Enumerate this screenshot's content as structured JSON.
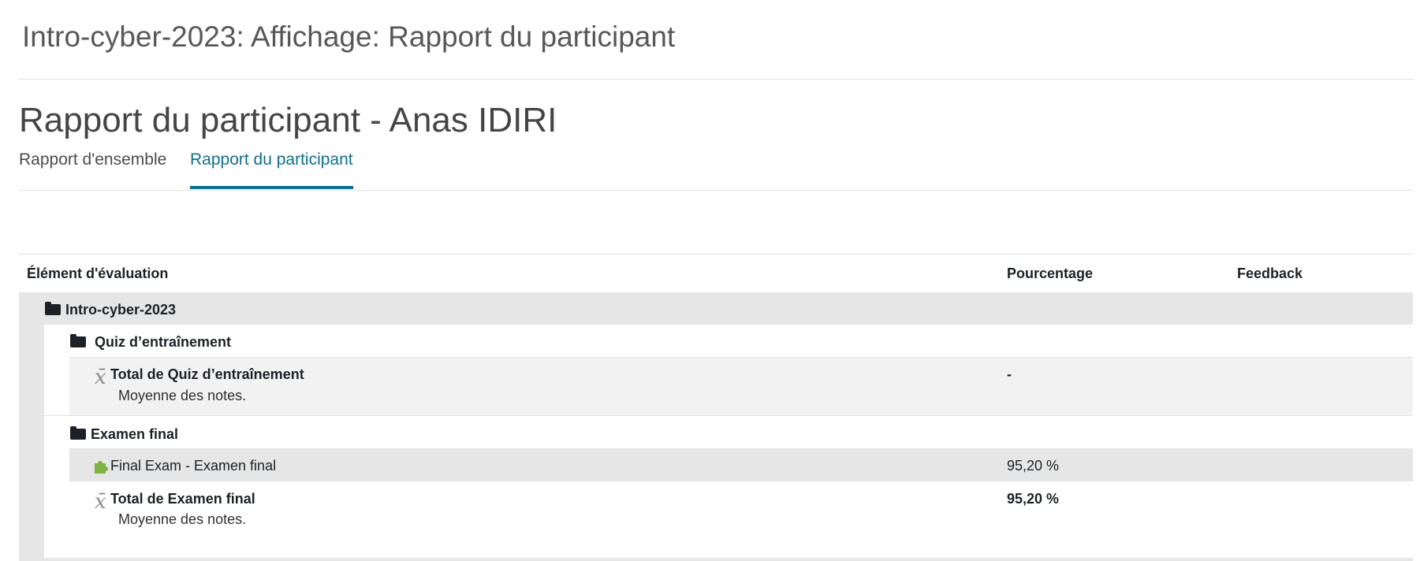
{
  "page": {
    "heading": "Intro-cyber-2023: Affichage: Rapport du participant",
    "report_title": "Rapport du participant - Anas IDIRI"
  },
  "tabs": [
    {
      "label": "Rapport d'ensemble",
      "active": false
    },
    {
      "label": "Rapport du participant",
      "active": true
    }
  ],
  "table": {
    "headers": {
      "item": "Élément d'évaluation",
      "percentage": "Pourcentage",
      "feedback": "Feedback"
    },
    "rows": [
      {
        "type": "category",
        "icon": "folder-icon",
        "name": "Intro-cyber-2023"
      },
      {
        "type": "category",
        "icon": "folder-icon",
        "name": "Quiz d’entraînement"
      },
      {
        "type": "total",
        "icon": "mean-icon",
        "name": "Total de Quiz d’entraînement",
        "sub": "Moyenne des notes.",
        "percentage": "-"
      },
      {
        "type": "category",
        "icon": "folder-icon",
        "name": "Examen final"
      },
      {
        "type": "item",
        "icon": "quiz-puzzle-icon",
        "name": "Final Exam - Examen final",
        "percentage": "95,20 %"
      },
      {
        "type": "total",
        "icon": "mean-icon",
        "name": "Total de Examen final",
        "sub": "Moyenne des notes.",
        "percentage": "95,20 %"
      }
    ]
  },
  "colors": {
    "accent": "#0f6e8c",
    "row_gray_dark": "#e6e6e6",
    "row_gray_light": "#f2f2f2",
    "icon_green": "#7cb342"
  }
}
